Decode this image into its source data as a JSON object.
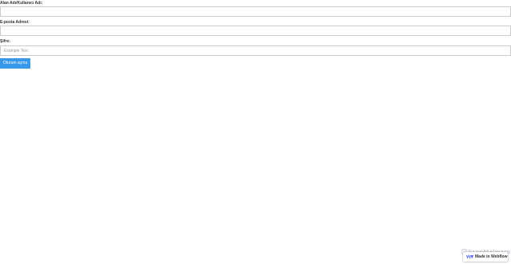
{
  "form": {
    "username_label": "Alan Adı/Kullanıcı Adı:",
    "username_value": "",
    "email_label": "E-posta Adresi:",
    "email_value": "",
    "password_label": "Şifre:",
    "password_placeholder": "Example Text",
    "submit_label": "Oturum açma"
  },
  "watermark": {
    "text": "ScanMalware",
    "icon": "scanmalware-logo-icon"
  },
  "badge": {
    "text": "Made in Webflow",
    "icon": "webflow-logo-icon"
  },
  "colors": {
    "button_background": "#3898ec",
    "button_text": "#ffffff",
    "input_border": "#cccccc",
    "label_text": "#333333",
    "webflow_blue": "#4353ff",
    "watermark": "#c9ced6"
  }
}
